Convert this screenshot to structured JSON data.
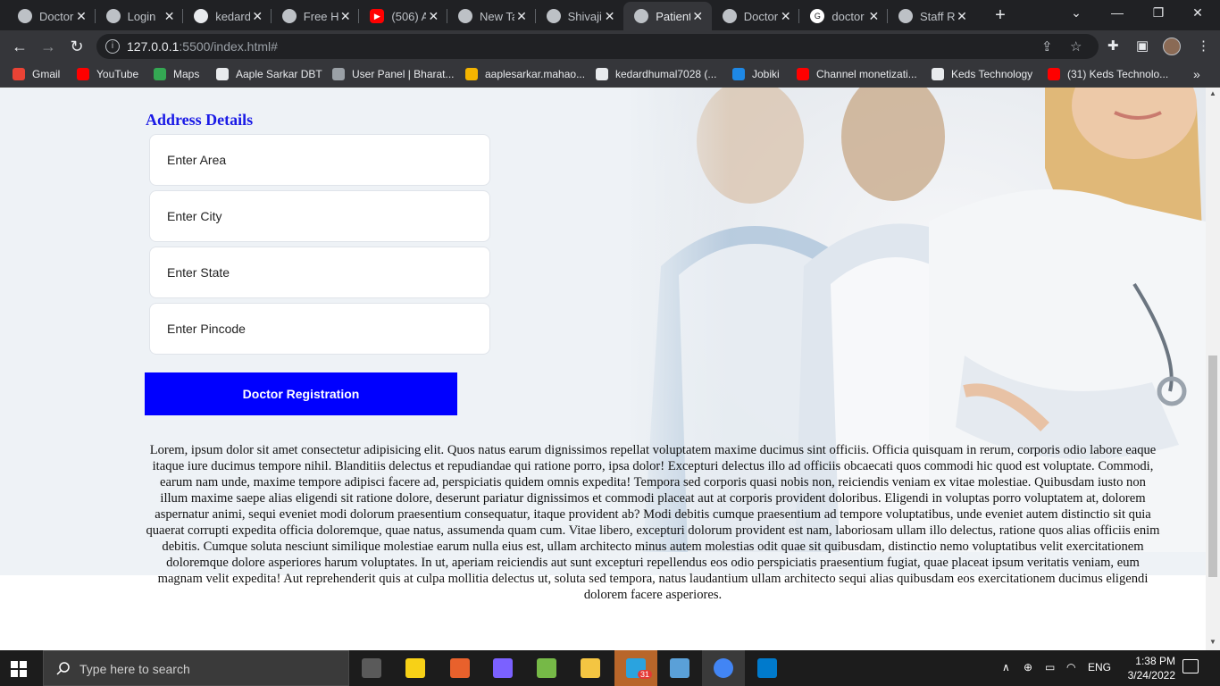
{
  "browser": {
    "tabs": [
      {
        "label": "Doctor",
        "icon": "globe-icon",
        "active": false
      },
      {
        "label": "Login",
        "icon": "globe-icon",
        "active": false
      },
      {
        "label": "kedard",
        "icon": "github-icon",
        "active": false
      },
      {
        "label": "Free H",
        "icon": "globe-icon",
        "active": false
      },
      {
        "label": "(506) A",
        "icon": "youtube-icon",
        "active": false
      },
      {
        "label": "New Ta",
        "icon": "globe-icon",
        "active": false
      },
      {
        "label": "Shivaji",
        "icon": "globe-icon",
        "active": false
      },
      {
        "label": "Patient",
        "icon": "globe-icon",
        "active": true
      },
      {
        "label": "Doctor",
        "icon": "globe-icon",
        "active": false
      },
      {
        "label": "doctor",
        "icon": "google-icon",
        "active": false
      },
      {
        "label": "Staff R",
        "icon": "globe-icon",
        "active": false
      }
    ],
    "url_host": "127.0.0.1",
    "url_rest": ":5500/index.html#",
    "bookmarks": [
      {
        "label": "Gmail",
        "color": "#ea4335"
      },
      {
        "label": "YouTube",
        "color": "#ff0000"
      },
      {
        "label": "Maps",
        "color": "#34a853"
      },
      {
        "label": "Aaple Sarkar DBT",
        "color": "#e8eaed"
      },
      {
        "label": "User Panel | Bharat...",
        "color": "#9aa0a6"
      },
      {
        "label": "aaplesarkar.mahao...",
        "color": "#f4b400"
      },
      {
        "label": "kedardhumal7028 (...",
        "color": "#e8eaed"
      },
      {
        "label": "Jobiki",
        "color": "#1e88e5"
      },
      {
        "label": "Channel monetizati...",
        "color": "#ff0000"
      },
      {
        "label": "Keds Technology",
        "color": "#e8eaed"
      },
      {
        "label": "(31) Keds Technolo...",
        "color": "#ff0000"
      }
    ]
  },
  "page": {
    "section_title": "Address Details",
    "fields": [
      {
        "placeholder": "Enter Area"
      },
      {
        "placeholder": "Enter City"
      },
      {
        "placeholder": "Enter State"
      },
      {
        "placeholder": "Enter Pincode"
      }
    ],
    "submit_label": "Doctor Registration",
    "body_text": "Lorem, ipsum dolor sit amet consectetur adipisicing elit. Quos natus earum dignissimos repellat voluptatem maxime ducimus sint officiis. Officia quisquam in rerum, corporis odio labore eaque itaque iure ducimus tempore nihil. Blanditiis delectus et repudiandae qui ratione porro, ipsa dolor! Excepturi delectus illo ad officiis obcaecati quos commodi hic quod est voluptate. Commodi, earum nam unde, maxime tempore adipisci facere ad, perspiciatis quidem omnis expedita! Tempora sed corporis quasi nobis non, reiciendis veniam ex vitae molestiae. Quibusdam iusto non illum maxime saepe alias eligendi sit ratione dolore, deserunt pariatur dignissimos et commodi placeat aut at corporis provident doloribus. Eligendi in voluptas porro voluptatem at, dolorem aspernatur animi, sequi eveniet modi dolorum praesentium consequatur, itaque provident ab? Modi debitis cumque praesentium ad tempore voluptatibus, unde eveniet autem distinctio sit quia quaerat corrupti expedita officia doloremque, quae natus, assumenda quam cum. Vitae libero, excepturi dolorum provident est nam, laboriosam ullam illo delectus, ratione quos alias officiis enim debitis. Cumque soluta nesciunt similique molestiae earum nulla eius est, ullam architecto minus autem molestias odit quae sit quibusdam, distinctio nemo voluptatibus velit exercitationem doloremque dolore asperiores harum voluptates. In ut, aperiam reiciendis aut sunt excepturi repellendus eos odio perspiciatis praesentium fugiat, quae placeat ipsum veritatis veniam, eum magnam velit expedita! Aut reprehenderit quis at culpa mollitia delectus ut, soluta sed tempora, natus laudantium ullam architecto sequi alias quibusdam eos exercitationem ducimus eligendi dolorem facere asperiores."
  },
  "taskbar": {
    "search_placeholder": "Type here to search",
    "apps": [
      {
        "name": "task-view",
        "color": "#5a5a5a"
      },
      {
        "name": "sticky-notes",
        "color": "#f7d117"
      },
      {
        "name": "git",
        "color": "#e8612c"
      },
      {
        "name": "infinity-app",
        "color": "#7b61ff"
      },
      {
        "name": "notepad-plus",
        "color": "#76b947"
      },
      {
        "name": "file-explorer",
        "color": "#f4c542"
      },
      {
        "name": "telegram",
        "color": "#2aa3df",
        "badge": "31"
      },
      {
        "name": "notepad",
        "color": "#5aa0d8"
      },
      {
        "name": "chrome",
        "color": "#4285f4"
      },
      {
        "name": "vscode",
        "color": "#007acc"
      }
    ],
    "language": "ENG",
    "time": "1:38 PM",
    "date": "3/24/2022"
  }
}
